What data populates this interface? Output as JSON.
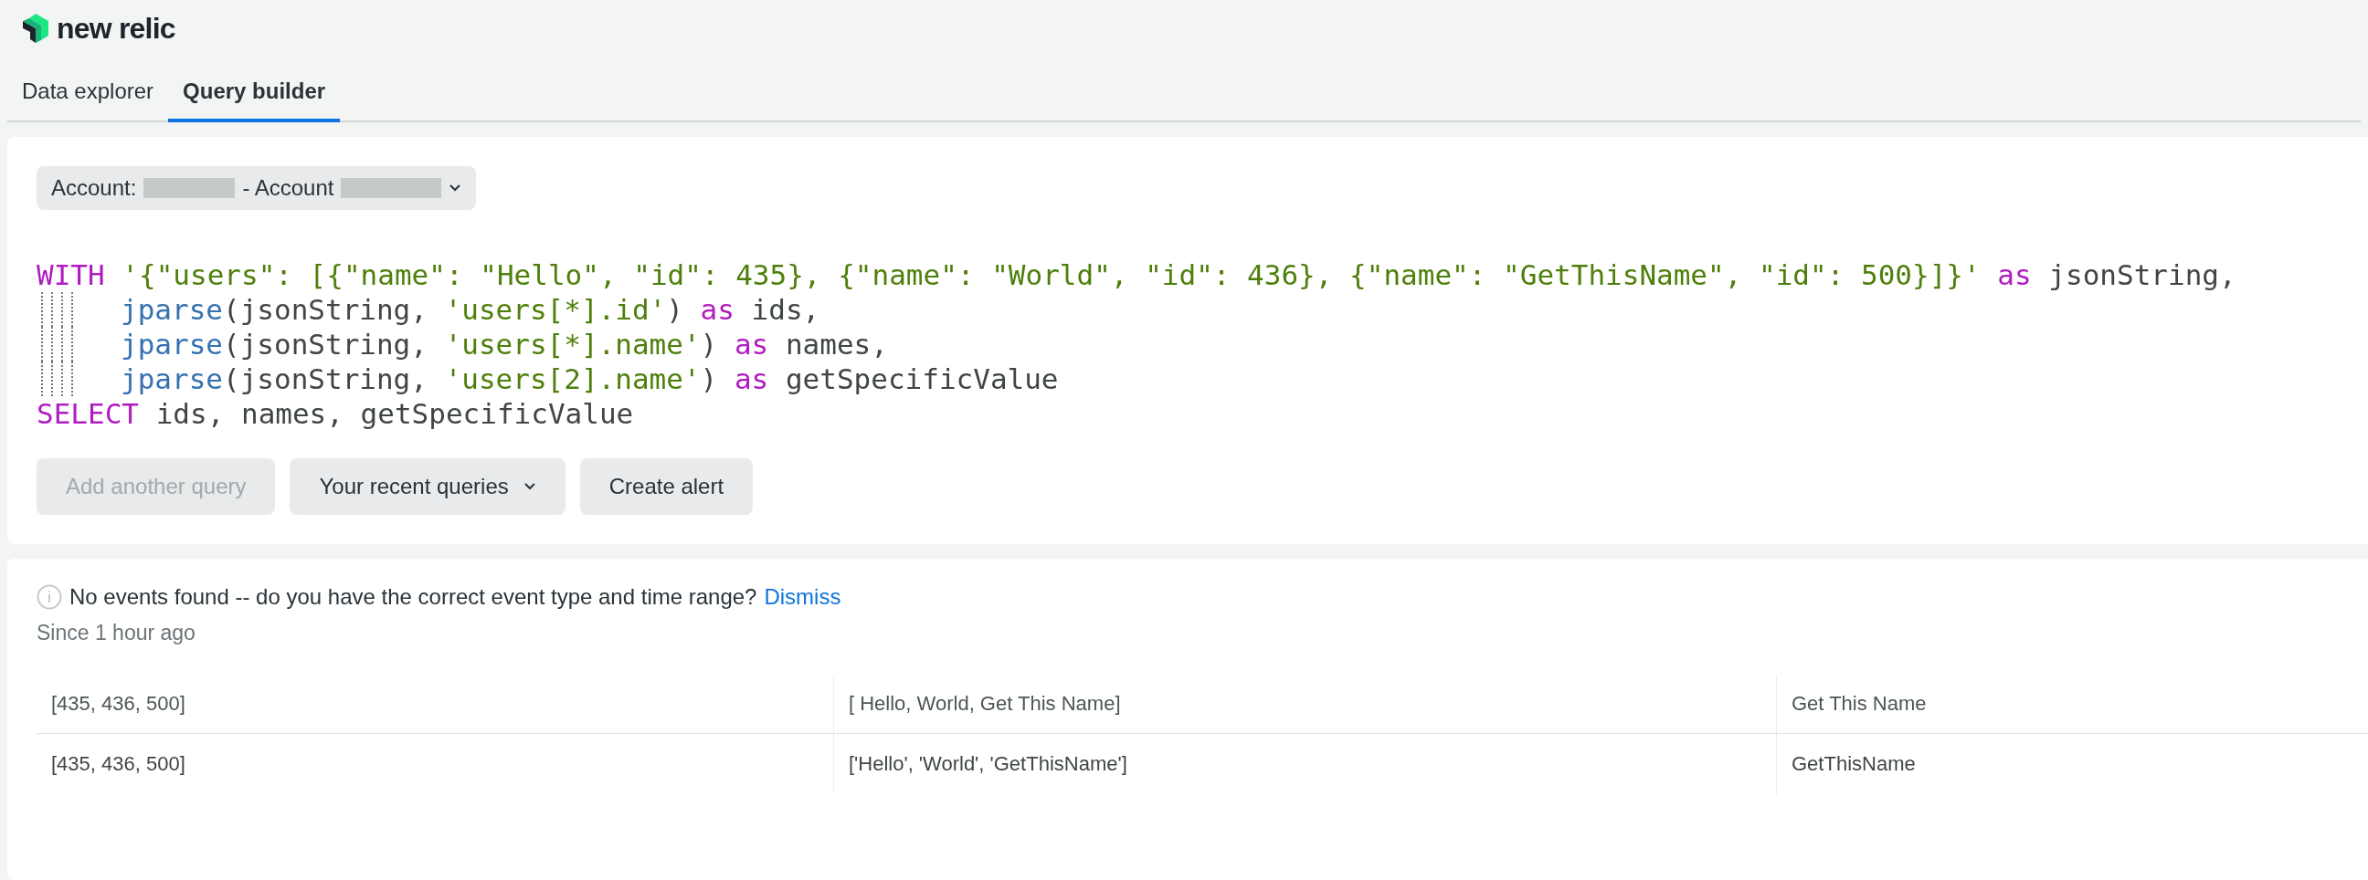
{
  "brand": {
    "name": "new relic"
  },
  "tabs": [
    {
      "label": "Data explorer",
      "selected": false
    },
    {
      "label": "Query builder",
      "selected": true
    }
  ],
  "account_selector": {
    "label": "Account:",
    "separator": "- Account"
  },
  "query_editor": {
    "lines": [
      {
        "indented": false,
        "tokens": [
          {
            "kind": "keyword",
            "text": "WITH"
          },
          {
            "kind": "string",
            "text": " '{\"users\": [{\"name\": \"Hello\", \"id\": 435}, {\"name\": \"World\", \"id\": 436}, {\"name\": \"GetThisName\", \"id\": 500}]}'"
          },
          {
            "kind": "keyword",
            "text": " as"
          },
          {
            "kind": "plain",
            "text": " jsonString,"
          }
        ]
      },
      {
        "indented": true,
        "tokens": [
          {
            "kind": "function",
            "text": "jparse"
          },
          {
            "kind": "plain",
            "text": "(jsonString, "
          },
          {
            "kind": "string",
            "text": "'users[*].id'"
          },
          {
            "kind": "plain",
            "text": ") "
          },
          {
            "kind": "keyword",
            "text": "as"
          },
          {
            "kind": "plain",
            "text": " ids,"
          }
        ]
      },
      {
        "indented": true,
        "tokens": [
          {
            "kind": "function",
            "text": "jparse"
          },
          {
            "kind": "plain",
            "text": "(jsonString, "
          },
          {
            "kind": "string",
            "text": "'users[*].name'"
          },
          {
            "kind": "plain",
            "text": ") "
          },
          {
            "kind": "keyword",
            "text": "as"
          },
          {
            "kind": "plain",
            "text": " names,"
          }
        ]
      },
      {
        "indented": true,
        "tokens": [
          {
            "kind": "function",
            "text": "jparse"
          },
          {
            "kind": "plain",
            "text": "(jsonString, "
          },
          {
            "kind": "string",
            "text": "'users[2].name'"
          },
          {
            "kind": "plain",
            "text": ") "
          },
          {
            "kind": "keyword",
            "text": "as"
          },
          {
            "kind": "plain",
            "text": " getSpecificValue"
          }
        ]
      },
      {
        "indented": false,
        "tokens": [
          {
            "kind": "keyword",
            "text": "SELECT"
          },
          {
            "kind": "plain",
            "text": " ids, names, getSpecificValue"
          }
        ]
      }
    ]
  },
  "actions": [
    {
      "label": "Add another query",
      "disabled": true,
      "dropdown": false
    },
    {
      "label": "Your recent queries",
      "disabled": false,
      "dropdown": true
    },
    {
      "label": "Create alert",
      "disabled": false,
      "dropdown": false
    }
  ],
  "notice": {
    "message": "No events found -- do you have the correct event type and time range?",
    "link": "Dismiss"
  },
  "time_range": "Since 1 hour ago",
  "table": {
    "columns": [
      "[435, 436, 500]",
      "[ Hello, World, Get This Name]",
      "Get This Name"
    ],
    "rows": [
      [
        "[435, 436, 500]",
        "['Hello', 'World', 'GetThisName']",
        "GetThisName"
      ]
    ]
  }
}
